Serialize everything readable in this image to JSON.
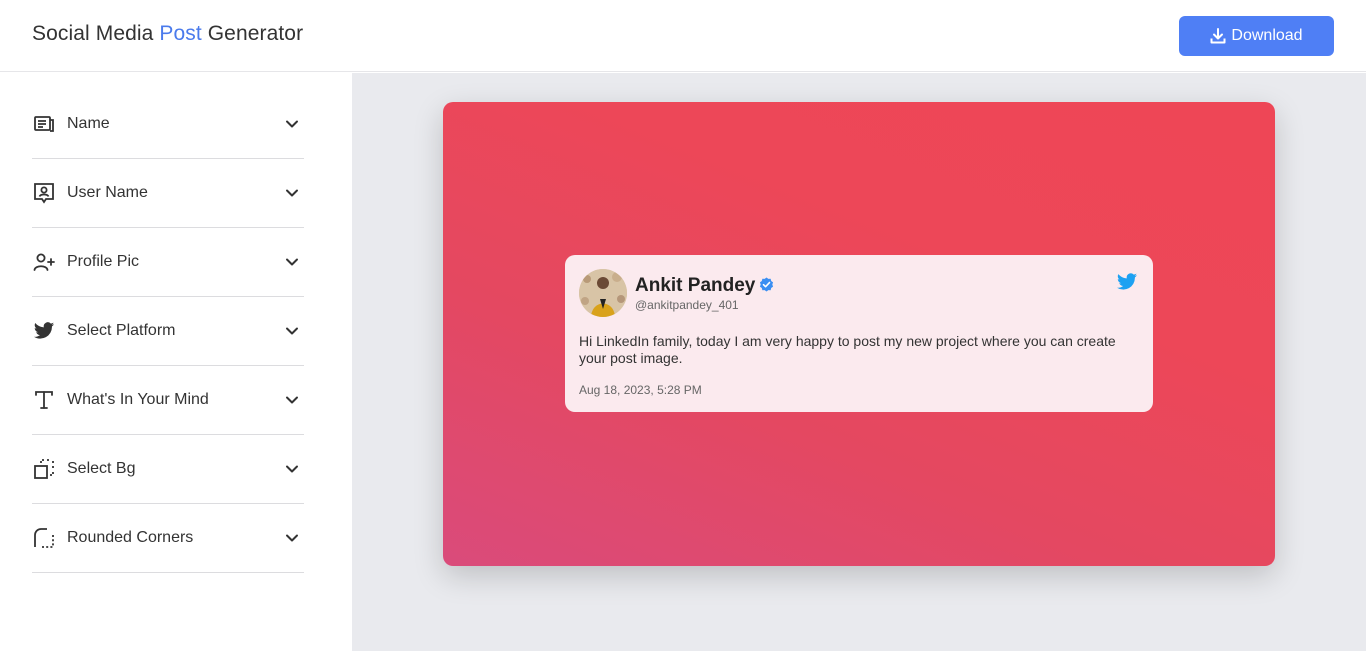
{
  "header": {
    "title_part1": "Social Media ",
    "title_accent": "Post",
    "title_part2": " Generator",
    "download_label": "Download",
    "accent_color": "#4b7bec"
  },
  "sidebar": {
    "items": [
      {
        "label": "Name",
        "icon": "name-card-icon"
      },
      {
        "label": "User Name",
        "icon": "user-badge-icon"
      },
      {
        "label": "Profile Pic",
        "icon": "user-plus-icon"
      },
      {
        "label": "Select Platform",
        "icon": "twitter-bird-icon"
      },
      {
        "label": "What's In Your Mind",
        "icon": "text-t-icon"
      },
      {
        "label": "Select Bg",
        "icon": "background-select-icon"
      },
      {
        "label": "Rounded Corners",
        "icon": "rounded-corner-icon"
      }
    ]
  },
  "post": {
    "author_name": "Ankit Pandey",
    "handle": "@ankitpandey_401",
    "text": "Hi LinkedIn family, today I am very happy to post my new project where you can create your post image.",
    "date": "Aug 18, 2023, 5:28 PM",
    "platform_icon": "twitter-bird-icon",
    "bg_gradient_colors": [
      "#da4b7b",
      "#ee4656"
    ],
    "card_color": "#fbeaee"
  }
}
